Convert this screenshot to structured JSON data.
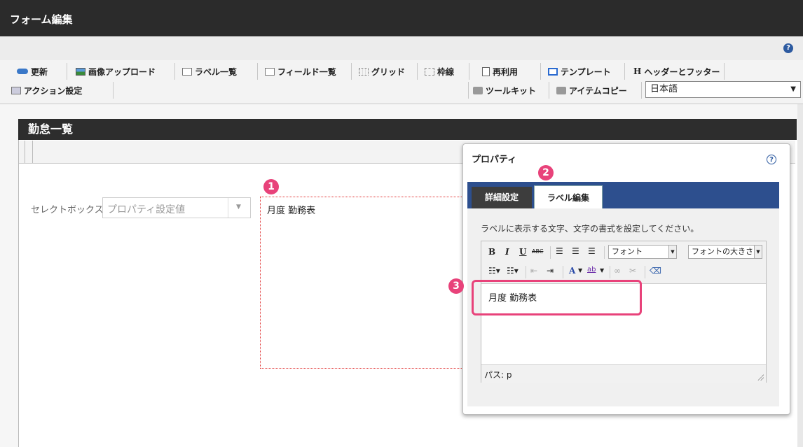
{
  "window": {
    "title": "フォーム編集"
  },
  "help": {
    "icon": "help-icon",
    "glyph": "?"
  },
  "toolbar": {
    "row1": [
      {
        "label": "更新",
        "icon": "refresh-icon"
      },
      {
        "label": "画像アップロード",
        "icon": "image-upload-icon"
      },
      {
        "label": "ラベル一覧",
        "icon": "label-list-icon"
      },
      {
        "label": "フィールド一覧",
        "icon": "field-list-icon"
      },
      {
        "label": "グリッド",
        "icon": "grid-icon"
      },
      {
        "label": "枠線",
        "icon": "frame-icon"
      },
      {
        "label": "再利用",
        "icon": "reuse-icon"
      },
      {
        "label": "テンプレート",
        "icon": "template-icon"
      },
      {
        "label": "ヘッダーとフッター",
        "icon": "header-footer-icon",
        "glyph": "H"
      }
    ],
    "row2_left": [
      {
        "label": "アクション設定",
        "icon": "action-icon"
      }
    ],
    "row2_right": [
      {
        "label": "ツールキット",
        "icon": "toolkit-icon"
      },
      {
        "label": "アイテムコピー",
        "icon": "item-copy-icon"
      }
    ],
    "language": "日本語"
  },
  "section": {
    "title": "勤怠一覧"
  },
  "form": {
    "select_label": "セレクトボックス",
    "select_value": "プロパティ設定値",
    "label_text": "月度 勤務表"
  },
  "badges": [
    "1",
    "2",
    "3"
  ],
  "dialog": {
    "title": "プロパティ",
    "help_glyph": "?",
    "tabs": [
      {
        "label": "詳細設定",
        "active": false
      },
      {
        "label": "ラベル編集",
        "active": true
      }
    ],
    "instruction": "ラベルに表示する文字、文字の書式を設定してください。",
    "editor": {
      "buttons": {
        "bold": "B",
        "italic": "I",
        "underline": "U",
        "strike": "ABC",
        "font_color": "A",
        "highlight": "ab"
      },
      "font_select": "フォント",
      "size_select": "フォントの大きさ",
      "content": "月度 勤務表",
      "status": "パス: p"
    }
  },
  "colors": {
    "accent": "#e8427a",
    "tabbar": "#2d4f8e",
    "titlebar": "#2b2b2b"
  }
}
